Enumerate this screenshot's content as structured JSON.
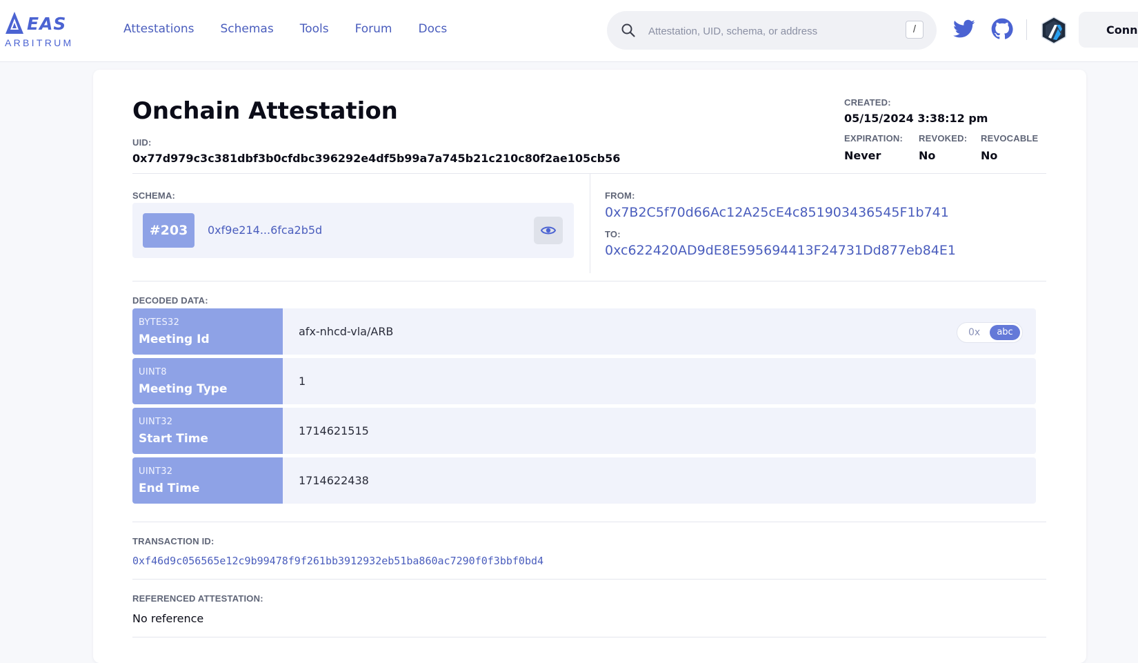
{
  "brand": {
    "name": "EAS",
    "network": "ARBITRUM",
    "accent": "#4b63d2"
  },
  "nav": {
    "items": [
      "Attestations",
      "Schemas",
      "Tools",
      "Forum",
      "Docs"
    ]
  },
  "search": {
    "placeholder": "Attestation, UID, schema, or address",
    "shortcut": "/"
  },
  "header_actions": {
    "connect_label": "Conne",
    "icons": [
      "twitter-icon",
      "github-icon",
      "arbitrum-icon"
    ]
  },
  "attestation": {
    "title": "Onchain Attestation",
    "uid_label": "UID:",
    "uid": "0x77d979c3c381dbf3b0cfdbc396292e4df5b99a7a745b21c210c80f2ae105cb56",
    "created_label": "CREATED:",
    "created": "05/15/2024 3:38:12 pm",
    "expiration_label": "EXPIRATION:",
    "expiration": "Never",
    "revoked_label": "REVOKED:",
    "revoked": "No",
    "revocable_label": "REVOCABLE",
    "revocable": "No",
    "schema_label": "SCHEMA:",
    "schema_number": "#203",
    "schema_id": "0xf9e214...6fca2b5d",
    "from_label": "FROM:",
    "from": "0x7B2C5f70d66Ac12A25cE4c851903436545F1b741",
    "to_label": "TO:",
    "to": "0xc622420AD9dE8E595694413F24731Dd877eb84E1",
    "decoded_label": "DECODED DATA:",
    "decoded": [
      {
        "type": "BYTES32",
        "name": "Meeting Id",
        "value": "afx-nhcd-vla/ARB"
      },
      {
        "type": "UINT8",
        "name": "Meeting Type",
        "value": "1"
      },
      {
        "type": "UINT32",
        "name": "Start Time",
        "value": "1714621515"
      },
      {
        "type": "UINT32",
        "name": "End Time",
        "value": "1714622438"
      }
    ],
    "format_toggle": {
      "hex": "0x",
      "text": "abc",
      "selected": "abc"
    },
    "tx_label": "TRANSACTION ID:",
    "tx_id": "0xf46d9c056565e12c9b99478f9f261bb3912932eb51ba860ac7290f0f3bbf0bd4",
    "ref_label": "REFERENCED ATTESTATION:",
    "ref_value": "No reference"
  }
}
